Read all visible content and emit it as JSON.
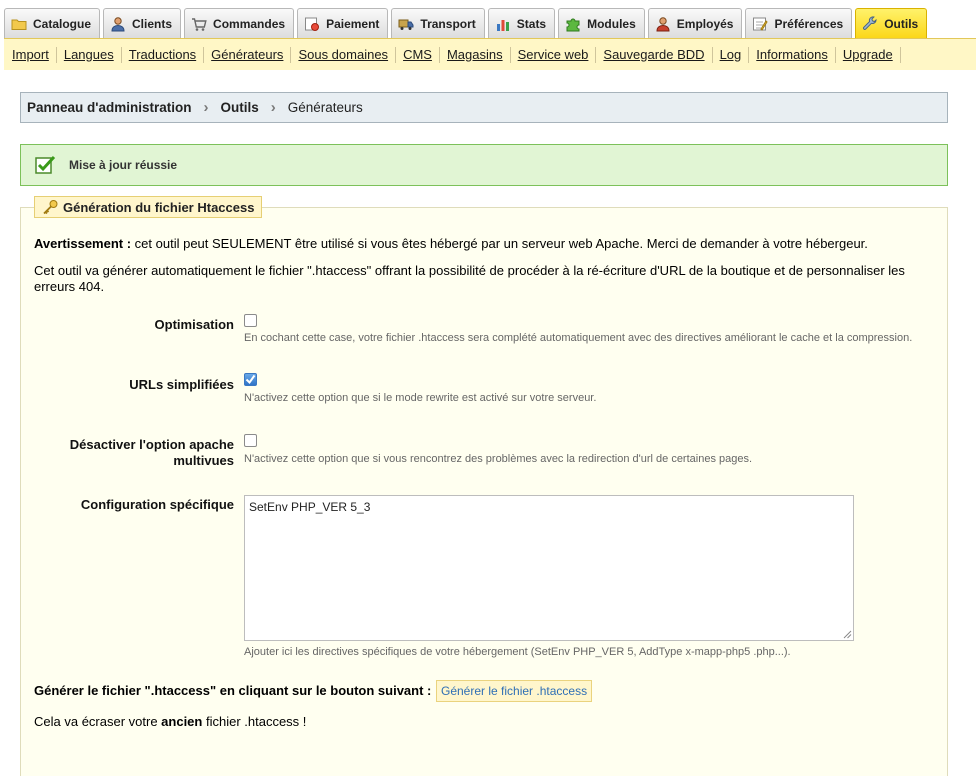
{
  "tabs": [
    {
      "label": "Catalogue",
      "icon": "folder-icon"
    },
    {
      "label": "Clients",
      "icon": "user-icon"
    },
    {
      "label": "Commandes",
      "icon": "cart-icon"
    },
    {
      "label": "Paiement",
      "icon": "payment-icon"
    },
    {
      "label": "Transport",
      "icon": "truck-icon"
    },
    {
      "label": "Stats",
      "icon": "chart-icon"
    },
    {
      "label": "Modules",
      "icon": "puzzle-icon"
    },
    {
      "label": "Employés",
      "icon": "employee-icon"
    },
    {
      "label": "Préférences",
      "icon": "preferences-icon"
    },
    {
      "label": "Outils",
      "icon": "wrench-icon",
      "active": true
    }
  ],
  "subnav": [
    "Import",
    "Langues",
    "Traductions",
    "Générateurs",
    "Sous domaines",
    "CMS",
    "Magasins",
    "Service web",
    "Sauvegarde BDD",
    "Log",
    "Informations",
    "Upgrade"
  ],
  "breadcrumb": {
    "root": "Panneau d'administration",
    "section": "Outils",
    "current": "Générateurs"
  },
  "success": {
    "message": "Mise à jour réussie",
    "icon": "checkmark-icon",
    "color": "#7cc15a"
  },
  "panel": {
    "legend": "Génération du fichier Htaccess",
    "legend_icon": "key-icon",
    "warning_bold": "Avertissement :",
    "warning_text": " cet outil peut SEULEMENT être utilisé si vous êtes hébergé par un serveur web Apache. Merci de demander à votre hébergeur.",
    "intro": "Cet outil va générer automatiquement le fichier \".htaccess\" offrant la possibilité de procéder à la ré-écriture d'URL de la boutique et de personnaliser les erreurs 404.",
    "optimisation": {
      "label": "Optimisation",
      "checked": false,
      "hint": "En cochant cette case, votre fichier .htaccess sera complété automatiquement avec des directives améliorant le cache et la compression."
    },
    "friendly_urls": {
      "label": "URLs simplifiées",
      "checked": true,
      "hint": "N'activez cette option que si le mode rewrite est activé sur votre serveur."
    },
    "multiviews": {
      "label_line1": "Désactiver l'option apache",
      "label_line2": "multivues",
      "checked": false,
      "hint": "N'activez cette option que si vous rencontrez des problèmes avec la redirection d'url de certaines pages."
    },
    "specific_config": {
      "label": "Configuration spécifique",
      "value": "SetEnv PHP_VER 5_3",
      "hint": "Ajouter ici les directives spécifiques de votre hébergement (SetEnv PHP_VER 5, AddType x-mapp-php5 .php...)."
    },
    "generate_label": "Générer le fichier \".htaccess\" en cliquant sur le bouton suivant :",
    "generate_button": "Générer le fichier .htaccess",
    "overwrite_before": "Cela va écraser votre ",
    "overwrite_bold": "ancien",
    "overwrite_after": " fichier .htaccess !"
  }
}
